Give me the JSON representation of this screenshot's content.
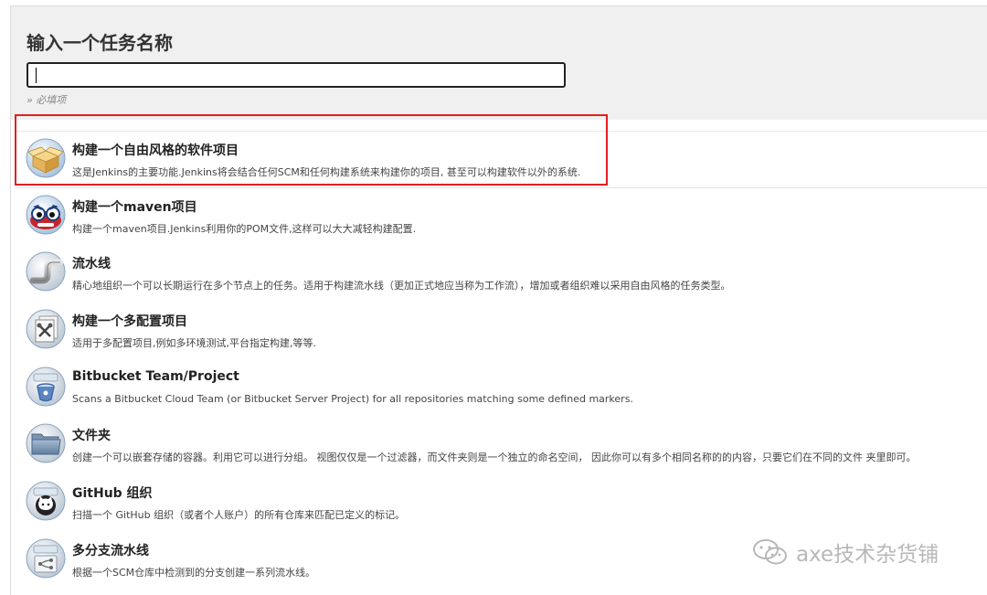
{
  "header": {
    "title": "输入一个任务名称",
    "input_value": "",
    "required_note": "» 必填项"
  },
  "items": [
    {
      "label": "构建一个自由风格的软件项目",
      "desc": "这是Jenkins的主要功能.Jenkins将会结合任何SCM和任何构建系统来构建你的项目, 甚至可以构建软件以外的系统.",
      "icon": "freestyle-box-icon"
    },
    {
      "label": "构建一个maven项目",
      "desc": "构建一个maven项目.Jenkins利用你的POM文件,这样可以大大减轻构建配置.",
      "icon": "maven-owl-icon"
    },
    {
      "label": "流水线",
      "desc": "精心地组织一个可以长期运行在多个节点上的任务。适用于构建流水线（更加正式地应当称为工作流），增加或者组织难以采用自由风格的任务类型。",
      "icon": "pipeline-icon"
    },
    {
      "label": "构建一个多配置项目",
      "desc": "适用于多配置项目,例如多环境测试,平台指定构建,等等.",
      "icon": "multi-config-icon"
    },
    {
      "label": "Bitbucket Team/Project",
      "desc": "Scans a Bitbucket Cloud Team (or Bitbucket Server Project) for all repositories matching some defined markers.",
      "icon": "bitbucket-icon"
    },
    {
      "label": "文件夹",
      "desc": "创建一个可以嵌套存储的容器。利用它可以进行分组。 视图仅仅是一个过滤器，而文件夹则是一个独立的命名空间， 因此你可以有多个相同名称的的内容，只要它们在不同的文件 夹里即可。",
      "icon": "folder-icon"
    },
    {
      "label": "GitHub 组织",
      "desc": "扫描一个 GitHub 组织（或者个人账户）的所有仓库来匹配已定义的标记。",
      "icon": "github-icon"
    },
    {
      "label": "多分支流水线",
      "desc": "根据一个SCM仓库中检测到的分支创建一系列流水线。",
      "icon": "multibranch-icon"
    }
  ],
  "watermark": {
    "text": "axe技术杂货铺",
    "icon": "wechat-icon"
  },
  "colors": {
    "highlight": "#e02020",
    "header_bg": "#f0f0f0"
  }
}
